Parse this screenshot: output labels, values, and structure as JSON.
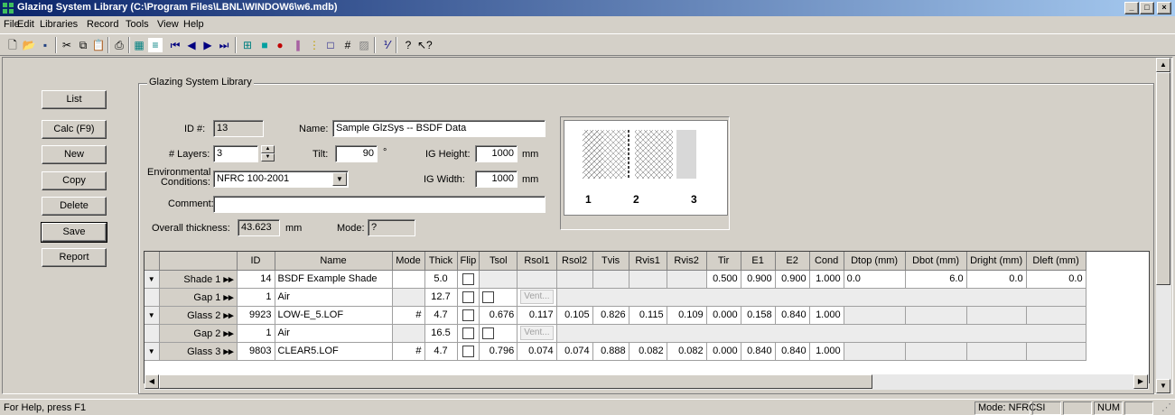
{
  "window": {
    "title": "Glazing System Library (C:\\Program Files\\LBNL\\WINDOW6\\w6.mdb)"
  },
  "menu": [
    "File",
    "Edit",
    "Libraries",
    "Record",
    "Tools",
    "View",
    "Help"
  ],
  "side_buttons": [
    "List",
    "Calc (F9)",
    "New",
    "Copy",
    "Delete",
    "Save",
    "Report"
  ],
  "form": {
    "group_title": "Glazing System Library",
    "id_label": "ID #:",
    "id_value": "13",
    "name_label": "Name:",
    "name_value": "Sample GlzSys -- BSDF Data",
    "layers_label": "# Layers:",
    "layers_value": "3",
    "tilt_label": "Tilt:",
    "tilt_value": "90",
    "tilt_unit": "°",
    "ig_height_label": "IG Height:",
    "ig_height_value": "1000",
    "ig_height_unit": "mm",
    "ig_width_label": "IG Width:",
    "ig_width_value": "1000",
    "ig_width_unit": "mm",
    "env_label_1": "Environmental",
    "env_label_2": "Conditions:",
    "env_value": "NFRC 100-2001",
    "comment_label": "Comment:",
    "comment_value": "",
    "thickness_label": "Overall thickness:",
    "thickness_value": "43.623",
    "thickness_unit": "mm",
    "mode_label": "Mode:",
    "mode_value": "?"
  },
  "preview": {
    "labels": [
      "1",
      "2",
      "3"
    ]
  },
  "grid": {
    "columns": [
      "",
      "ID",
      "Name",
      "Mode",
      "Thick",
      "Flip",
      "Tsol",
      "Rsol1",
      "Rsol2",
      "Tvis",
      "Rvis1",
      "Rvis2",
      "Tir",
      "E1",
      "E2",
      "Cond",
      "Dtop (mm)",
      "Dbot (mm)",
      "Dright (mm)",
      "Dleft (mm)"
    ],
    "rows": [
      {
        "label": "Shade 1",
        "id": "14",
        "name": "BSDF Example Shade",
        "mode": "",
        "thick": "5.0",
        "tsol": "",
        "rsol1": "",
        "rsol2": "",
        "tvis": "",
        "rvis1": "",
        "rvis2": "",
        "tir": "0.500",
        "e1": "0.900",
        "e2": "0.900",
        "cond": "1.000",
        "dtop": "0.0",
        "dbot": "6.0",
        "dright": "0.0",
        "dleft": "0.0",
        "type": "layer"
      },
      {
        "label": "Gap 1",
        "id": "1",
        "name": "Air",
        "thick": "12.7",
        "vent": "Vent...",
        "type": "gap"
      },
      {
        "label": "Glass 2",
        "id": "9923",
        "name": "LOW-E_5.LOF",
        "mode": "#",
        "thick": "4.7",
        "tsol": "0.676",
        "rsol1": "0.117",
        "rsol2": "0.105",
        "tvis": "0.826",
        "rvis1": "0.115",
        "rvis2": "0.109",
        "tir": "0.000",
        "e1": "0.158",
        "e2": "0.840",
        "cond": "1.000",
        "dtop": "",
        "dbot": "",
        "dright": "",
        "dleft": "",
        "type": "layer"
      },
      {
        "label": "Gap 2",
        "id": "1",
        "name": "Air",
        "thick": "16.5",
        "vent": "Vent...",
        "type": "gap"
      },
      {
        "label": "Glass 3",
        "id": "9803",
        "name": "CLEAR5.LOF",
        "mode": "#",
        "thick": "4.7",
        "tsol": "0.796",
        "rsol1": "0.074",
        "rsol2": "0.074",
        "tvis": "0.888",
        "rvis1": "0.082",
        "rvis2": "0.082",
        "tir": "0.000",
        "e1": "0.840",
        "e2": "0.840",
        "cond": "1.000",
        "dtop": "",
        "dbot": "",
        "dright": "",
        "dleft": "",
        "type": "layer"
      }
    ]
  },
  "status": {
    "help": "For Help, press F1",
    "mode": "Mode: NFRC",
    "units": "SI",
    "num": "NUM"
  }
}
